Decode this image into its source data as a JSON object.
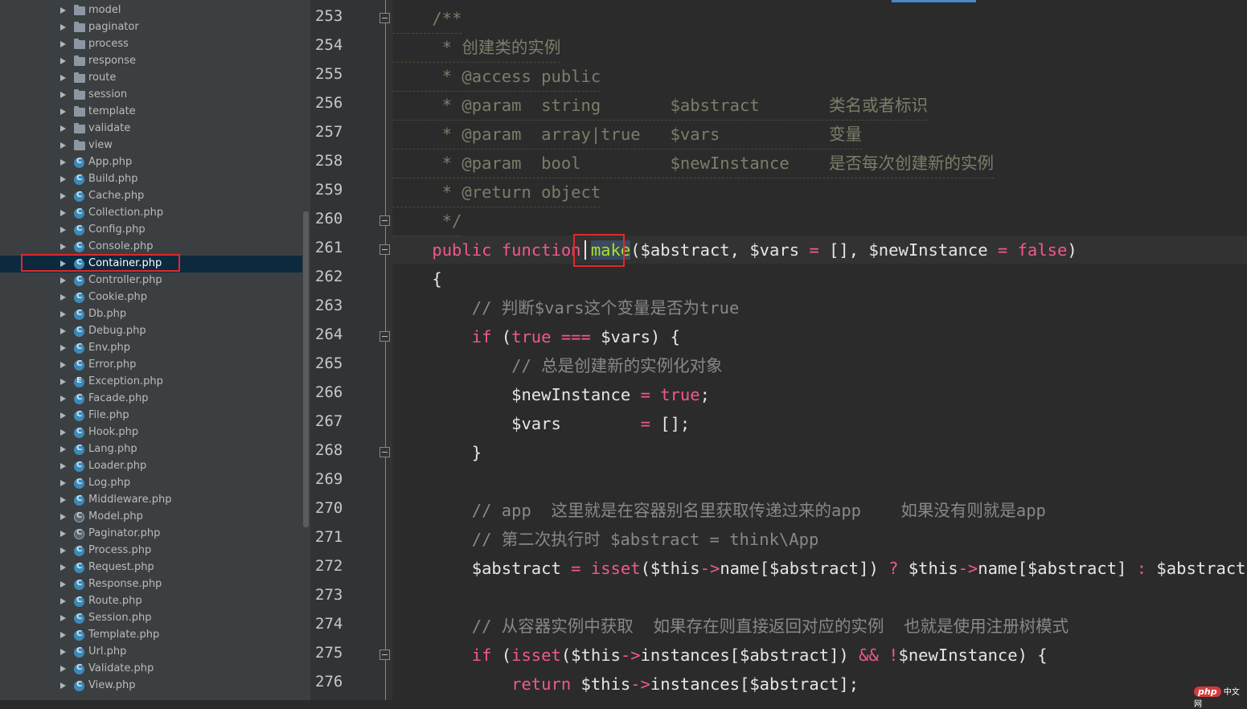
{
  "sidebar": {
    "items": [
      {
        "label": "model",
        "kind": "folder"
      },
      {
        "label": "paginator",
        "kind": "folder"
      },
      {
        "label": "process",
        "kind": "folder"
      },
      {
        "label": "response",
        "kind": "folder"
      },
      {
        "label": "route",
        "kind": "folder"
      },
      {
        "label": "session",
        "kind": "folder"
      },
      {
        "label": "template",
        "kind": "folder"
      },
      {
        "label": "validate",
        "kind": "folder"
      },
      {
        "label": "view",
        "kind": "folder"
      },
      {
        "label": "App.php",
        "kind": "class"
      },
      {
        "label": "Build.php",
        "kind": "class"
      },
      {
        "label": "Cache.php",
        "kind": "class"
      },
      {
        "label": "Collection.php",
        "kind": "class"
      },
      {
        "label": "Config.php",
        "kind": "class"
      },
      {
        "label": "Console.php",
        "kind": "class"
      },
      {
        "label": "Container.php",
        "kind": "class",
        "selected": true
      },
      {
        "label": "Controller.php",
        "kind": "class"
      },
      {
        "label": "Cookie.php",
        "kind": "class"
      },
      {
        "label": "Db.php",
        "kind": "class"
      },
      {
        "label": "Debug.php",
        "kind": "class"
      },
      {
        "label": "Env.php",
        "kind": "class"
      },
      {
        "label": "Error.php",
        "kind": "class"
      },
      {
        "label": "Exception.php",
        "kind": "exception"
      },
      {
        "label": "Facade.php",
        "kind": "class"
      },
      {
        "label": "File.php",
        "kind": "class"
      },
      {
        "label": "Hook.php",
        "kind": "class"
      },
      {
        "label": "Lang.php",
        "kind": "class"
      },
      {
        "label": "Loader.php",
        "kind": "class"
      },
      {
        "label": "Log.php",
        "kind": "class"
      },
      {
        "label": "Middleware.php",
        "kind": "class"
      },
      {
        "label": "Model.php",
        "kind": "abstract"
      },
      {
        "label": "Paginator.php",
        "kind": "abstract"
      },
      {
        "label": "Process.php",
        "kind": "class"
      },
      {
        "label": "Request.php",
        "kind": "class"
      },
      {
        "label": "Response.php",
        "kind": "class"
      },
      {
        "label": "Route.php",
        "kind": "class"
      },
      {
        "label": "Session.php",
        "kind": "class"
      },
      {
        "label": "Template.php",
        "kind": "class"
      },
      {
        "label": "Url.php",
        "kind": "class"
      },
      {
        "label": "Validate.php",
        "kind": "class"
      },
      {
        "label": "View.php",
        "kind": "class"
      }
    ]
  },
  "editor": {
    "line_numbers": [
      "253",
      "254",
      "255",
      "256",
      "257",
      "258",
      "259",
      "260",
      "261",
      "262",
      "263",
      "264",
      "265",
      "266",
      "267",
      "268",
      "269",
      "270",
      "271",
      "272",
      "273",
      "274",
      "275",
      "276"
    ],
    "lines": [
      {
        "doc": true,
        "tokens": [
          {
            "c": "c-doc",
            "t": "    /**"
          }
        ]
      },
      {
        "doc": true,
        "tokens": [
          {
            "c": "c-doc",
            "t": "     * 创建类的实例"
          }
        ]
      },
      {
        "doc": true,
        "tokens": [
          {
            "c": "c-doc",
            "t": "     * @access public"
          }
        ]
      },
      {
        "doc": true,
        "tokens": [
          {
            "c": "c-doc",
            "t": "     * @param  string       $abstract       类名或者标识"
          }
        ]
      },
      {
        "doc": true,
        "tokens": [
          {
            "c": "c-doc",
            "t": "     * @param  array|true   $vars           变量"
          }
        ]
      },
      {
        "doc": true,
        "tokens": [
          {
            "c": "c-doc",
            "t": "     * @param  bool         $newInstance    是否每次创建新的实例"
          }
        ]
      },
      {
        "doc": true,
        "tokens": [
          {
            "c": "c-doc",
            "t": "     * @return object"
          }
        ]
      },
      {
        "doc": true,
        "tokens": [
          {
            "c": "c-doc",
            "t": "     */"
          }
        ]
      },
      {
        "tokens": [
          {
            "c": "c-kw",
            "t": "    public function "
          },
          {
            "c": "c-fn make-hl",
            "t": "make"
          },
          {
            "c": "c-plain",
            "t": "($abstract, $vars "
          },
          {
            "c": "c-op",
            "t": "="
          },
          {
            "c": "c-plain",
            "t": " [], $newInstance "
          },
          {
            "c": "c-op",
            "t": "="
          },
          {
            "c": "c-kw",
            "t": " false"
          },
          {
            "c": "c-plain",
            "t": ")"
          }
        ]
      },
      {
        "tokens": [
          {
            "c": "c-plain",
            "t": "    {"
          }
        ]
      },
      {
        "tokens": [
          {
            "c": "c-com",
            "t": "        // 判断$vars这个变量是否为true"
          }
        ]
      },
      {
        "tokens": [
          {
            "c": "c-kw",
            "t": "        if "
          },
          {
            "c": "c-plain",
            "t": "("
          },
          {
            "c": "c-kw",
            "t": "true === "
          },
          {
            "c": "c-plain",
            "t": "$vars) {"
          }
        ]
      },
      {
        "tokens": [
          {
            "c": "c-com",
            "t": "            // 总是创建新的实例化对象"
          }
        ]
      },
      {
        "tokens": [
          {
            "c": "c-plain",
            "t": "            $newInstance "
          },
          {
            "c": "c-op",
            "t": "= "
          },
          {
            "c": "c-kw",
            "t": "true"
          },
          {
            "c": "c-plain",
            "t": ";"
          }
        ]
      },
      {
        "tokens": [
          {
            "c": "c-plain",
            "t": "            $vars        "
          },
          {
            "c": "c-op",
            "t": "= "
          },
          {
            "c": "c-plain",
            "t": "[];"
          }
        ]
      },
      {
        "tokens": [
          {
            "c": "c-plain",
            "t": "        }"
          }
        ]
      },
      {
        "tokens": [
          {
            "c": "c-plain",
            "t": ""
          }
        ]
      },
      {
        "tokens": [
          {
            "c": "c-com",
            "t": "        // app  这里就是在容器别名里获取传递过来的app    如果没有则就是app"
          }
        ]
      },
      {
        "tokens": [
          {
            "c": "c-com",
            "t": "        // 第二次执行时 $abstract = think\\App"
          }
        ]
      },
      {
        "tokens": [
          {
            "c": "c-plain",
            "t": "        $abstract "
          },
          {
            "c": "c-op",
            "t": "= "
          },
          {
            "c": "c-kw",
            "t": "isset"
          },
          {
            "c": "c-plain",
            "t": "($this"
          },
          {
            "c": "c-op",
            "t": "->"
          },
          {
            "c": "c-plain",
            "t": "name[$abstract]) "
          },
          {
            "c": "c-op",
            "t": "? "
          },
          {
            "c": "c-plain",
            "t": "$this"
          },
          {
            "c": "c-op",
            "t": "->"
          },
          {
            "c": "c-plain",
            "t": "name[$abstract] "
          },
          {
            "c": "c-op",
            "t": ": "
          },
          {
            "c": "c-plain",
            "t": "$abstract;"
          }
        ]
      },
      {
        "tokens": [
          {
            "c": "c-plain",
            "t": ""
          }
        ]
      },
      {
        "tokens": [
          {
            "c": "c-com",
            "t": "        // 从容器实例中获取  如果存在则直接返回对应的实例  也就是使用注册树模式"
          }
        ]
      },
      {
        "tokens": [
          {
            "c": "c-kw",
            "t": "        if "
          },
          {
            "c": "c-plain",
            "t": "("
          },
          {
            "c": "c-kw",
            "t": "isset"
          },
          {
            "c": "c-plain",
            "t": "($this"
          },
          {
            "c": "c-op",
            "t": "->"
          },
          {
            "c": "c-plain",
            "t": "instances[$abstract]) "
          },
          {
            "c": "c-op",
            "t": "&& !"
          },
          {
            "c": "c-plain",
            "t": "$newInstance) {"
          }
        ]
      },
      {
        "tokens": [
          {
            "c": "c-kw",
            "t": "            return "
          },
          {
            "c": "c-plain",
            "t": "$this"
          },
          {
            "c": "c-op",
            "t": "->"
          },
          {
            "c": "c-plain",
            "t": "instances[$abstract];"
          }
        ]
      }
    ],
    "fold_lines": [
      "253",
      "260",
      "261",
      "264",
      "268",
      "275"
    ]
  },
  "watermark": {
    "pill": "php",
    "text": "中文网"
  }
}
